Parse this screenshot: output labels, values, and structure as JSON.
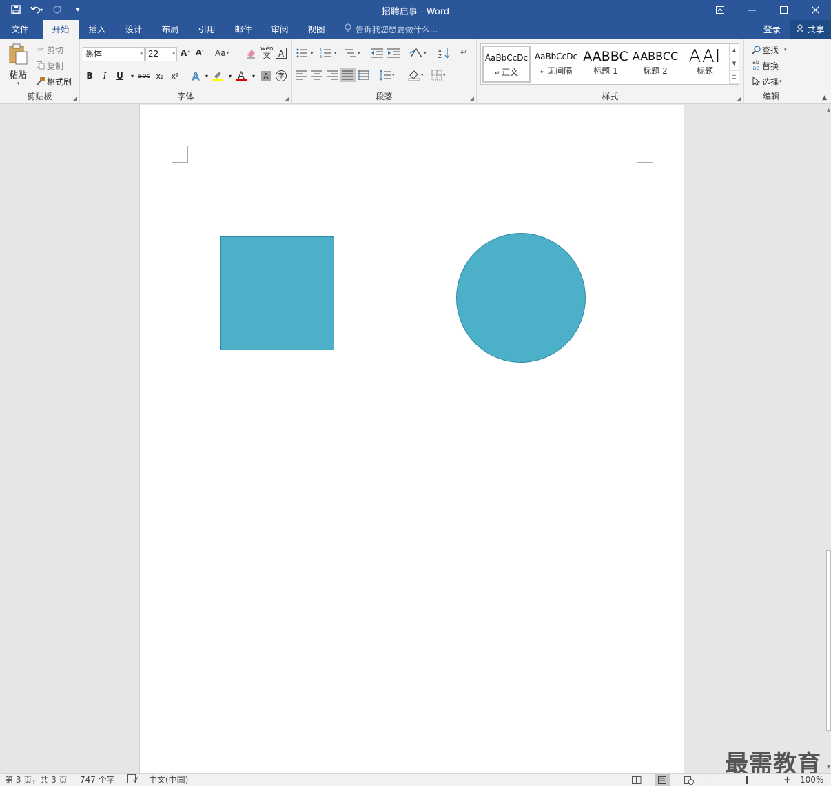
{
  "titlebar": {
    "title": "招聘启事 - Word",
    "save_icon": "save-icon",
    "undo_icon": "undo-icon",
    "redo_icon": "redo-icon"
  },
  "tabs": {
    "file": "文件",
    "home": "开始",
    "insert": "插入",
    "design": "设计",
    "layout": "布局",
    "references": "引用",
    "mailings": "邮件",
    "review": "审阅",
    "view": "视图",
    "tell_me": "告诉我您想要做什么...",
    "login": "登录",
    "share": "共享"
  },
  "clipboard": {
    "paste": "粘贴",
    "cut": "剪切",
    "copy": "复制",
    "format_painter": "格式刷",
    "label": "剪贴板"
  },
  "font": {
    "name": "黑体",
    "size": "22",
    "change_case": "Aa",
    "bold": "B",
    "italic": "I",
    "underline": "U",
    "strikethrough": "abc",
    "subscript": "x₂",
    "superscript": "x²",
    "label": "字体"
  },
  "paragraph": {
    "label": "段落"
  },
  "styles": {
    "label": "样式",
    "items": [
      {
        "sample": "AaBbCcDc",
        "name": "正文"
      },
      {
        "sample": "AaBbCcDc",
        "name": "无间隔"
      },
      {
        "sample": "AABBC",
        "name": "标题 1"
      },
      {
        "sample": "AABBCC",
        "name": "标题 2"
      },
      {
        "sample": "AAI",
        "name": "标题"
      }
    ]
  },
  "editing": {
    "find": "查找",
    "replace": "替换",
    "select": "选择",
    "label": "编辑"
  },
  "statusbar": {
    "page": "第 3 页，共 3 页",
    "words": "747 个字",
    "language": "中文(中国)",
    "zoom": "100%"
  },
  "watermark": "最需教育",
  "colors": {
    "titlebar": "#2b579a",
    "shape_fill": "#4cb1c8",
    "shape_border": "#2f8ba3"
  }
}
